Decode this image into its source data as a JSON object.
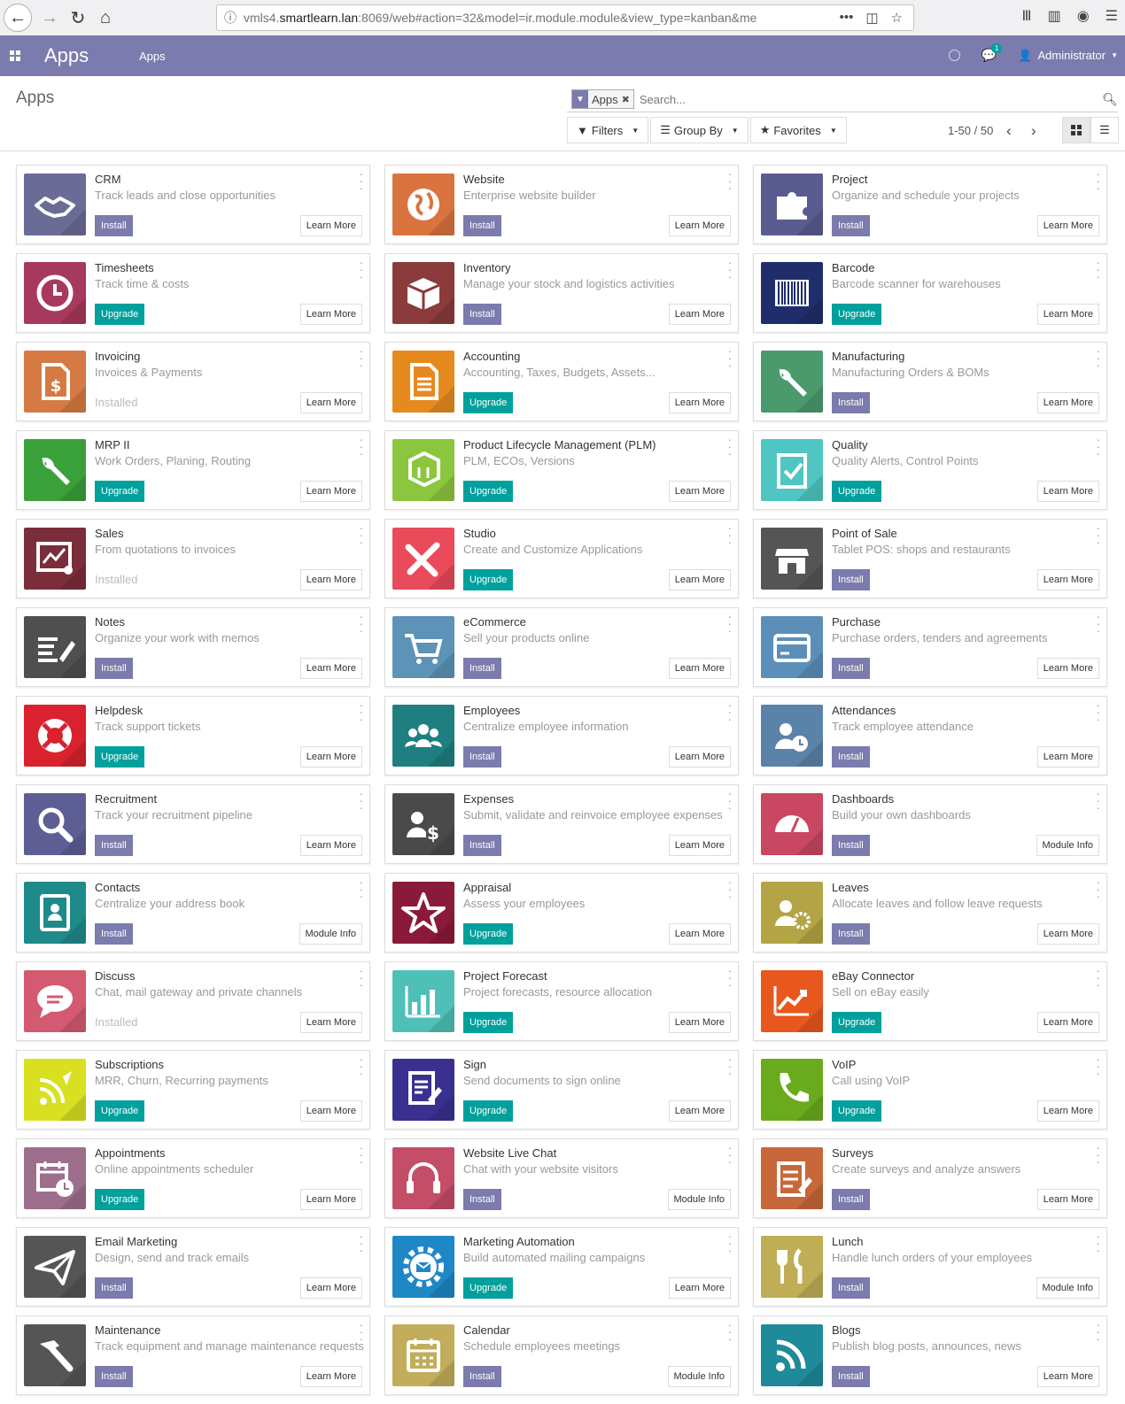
{
  "browser": {
    "url_prefix": "vmls4.",
    "url_host": "smartlearn.lan",
    "url_rest": ":8069/web#action=32&model=ir.module.module&view_type=kanban&me",
    "more_glyph": "•••"
  },
  "navbar": {
    "brand": "Apps",
    "menu_apps": "Apps",
    "chat_count": "1",
    "user": "Administrator",
    "color": "#7c7bad"
  },
  "control_panel": {
    "breadcrumb": "Apps",
    "facet": "Apps",
    "search_placeholder": "Search...",
    "filters_label": "Filters",
    "groupby_label": "Group By",
    "favorites_label": "Favorites",
    "pager": "1-50 / 50"
  },
  "colors": {
    "install": "#7c7bad",
    "upgrade": "#00a09d"
  },
  "apps": [
    {
      "name": "CRM",
      "summary": "Track leads and close opportunities",
      "state": "install",
      "info": "Learn More",
      "icon": "handshake-icon",
      "color": "#6b6b98"
    },
    {
      "name": "Website",
      "summary": "Enterprise website builder",
      "state": "install",
      "info": "Learn More",
      "icon": "globe-icon",
      "color": "#d9743f"
    },
    {
      "name": "Project",
      "summary": "Organize and schedule your projects",
      "state": "install",
      "info": "Learn More",
      "icon": "puzzle-icon",
      "color": "#5a5c8f"
    },
    {
      "name": "Timesheets",
      "summary": "Track time & costs",
      "state": "upgrade",
      "info": "Learn More",
      "icon": "clock-icon",
      "color": "#a73a5c"
    },
    {
      "name": "Inventory",
      "summary": "Manage your stock and logistics activities",
      "state": "install",
      "info": "Learn More",
      "icon": "box-icon",
      "color": "#8b3b3b"
    },
    {
      "name": "Barcode",
      "summary": "Barcode scanner for warehouses",
      "state": "upgrade",
      "info": "Learn More",
      "icon": "barcode-icon",
      "color": "#1f2d6b"
    },
    {
      "name": "Invoicing",
      "summary": "Invoices & Payments",
      "state": "installed",
      "state_text": "Installed",
      "info": "Learn More",
      "icon": "invoice-icon",
      "color": "#d67a44"
    },
    {
      "name": "Accounting",
      "summary": "Accounting, Taxes, Budgets, Assets...",
      "state": "upgrade",
      "info": "Learn More",
      "icon": "document-icon",
      "color": "#e68a1f"
    },
    {
      "name": "Manufacturing",
      "summary": "Manufacturing Orders & BOMs",
      "state": "install",
      "info": "Learn More",
      "icon": "wrench-icon",
      "color": "#4a9a6e"
    },
    {
      "name": "MRP II",
      "summary": "Work Orders, Planing, Routing",
      "state": "upgrade",
      "info": "Learn More",
      "icon": "wrench-icon",
      "color": "#3aa13a"
    },
    {
      "name": "Product Lifecycle Management (PLM)",
      "summary": "PLM, ECOs, Versions",
      "state": "upgrade",
      "info": "Learn More",
      "icon": "cube-icon",
      "color": "#8cc63f"
    },
    {
      "name": "Quality",
      "summary": "Quality Alerts, Control Points",
      "state": "upgrade",
      "info": "Learn More",
      "icon": "clipboard-check-icon",
      "color": "#4fc6c1"
    },
    {
      "name": "Sales",
      "summary": "From quotations to invoices",
      "state": "installed",
      "state_text": "Installed",
      "info": "Learn More",
      "icon": "chart-icon",
      "color": "#7b2d3a"
    },
    {
      "name": "Studio",
      "summary": "Create and Customize Applications",
      "state": "upgrade",
      "info": "Learn More",
      "icon": "tools-icon",
      "color": "#e94b5a"
    },
    {
      "name": "Point of Sale",
      "summary": "Tablet POS: shops and restaurants",
      "state": "install",
      "info": "Learn More",
      "icon": "shop-icon",
      "color": "#555555"
    },
    {
      "name": "Notes",
      "summary": "Organize your work with memos",
      "state": "install",
      "info": "Learn More",
      "icon": "notes-icon",
      "color": "#4f4f4f"
    },
    {
      "name": "eCommerce",
      "summary": "Sell your products online",
      "state": "install",
      "info": "Learn More",
      "icon": "cart-icon",
      "color": "#5c93b6"
    },
    {
      "name": "Purchase",
      "summary": "Purchase orders, tenders and agreements",
      "state": "install",
      "info": "Learn More",
      "icon": "card-icon",
      "color": "#5b8fba"
    },
    {
      "name": "Helpdesk",
      "summary": "Track support tickets",
      "state": "upgrade",
      "info": "Learn More",
      "icon": "lifebuoy-icon",
      "color": "#d9222e"
    },
    {
      "name": "Employees",
      "summary": "Centralize employee information",
      "state": "install",
      "info": "Learn More",
      "icon": "users-icon",
      "color": "#1f7f80"
    },
    {
      "name": "Attendances",
      "summary": "Track employee attendance",
      "state": "install",
      "info": "Learn More",
      "icon": "user-clock-icon",
      "color": "#5b83aa"
    },
    {
      "name": "Recruitment",
      "summary": "Track your recruitment pipeline",
      "state": "install",
      "info": "Learn More",
      "icon": "magnifier-icon",
      "color": "#5d5f94"
    },
    {
      "name": "Expenses",
      "summary": "Submit, validate and reinvoice employee expenses",
      "state": "install",
      "info": "Learn More",
      "icon": "user-dollar-icon",
      "color": "#4a4a4a"
    },
    {
      "name": "Dashboards",
      "summary": "Build your own dashboards",
      "state": "install",
      "info": "Module Info",
      "icon": "gauge-icon",
      "color": "#c94763"
    },
    {
      "name": "Contacts",
      "summary": "Centralize your address book",
      "state": "install",
      "info": "Module Info",
      "icon": "address-book-icon",
      "color": "#1f8a8a"
    },
    {
      "name": "Appraisal",
      "summary": "Assess your employees",
      "state": "upgrade",
      "info": "Learn More",
      "icon": "star-icon",
      "color": "#8a1a3a"
    },
    {
      "name": "Leaves",
      "summary": "Allocate leaves and follow leave requests",
      "state": "install",
      "info": "Learn More",
      "icon": "user-gear-icon",
      "color": "#b3a545"
    },
    {
      "name": "Discuss",
      "summary": "Chat, mail gateway and private channels",
      "state": "installed",
      "state_text": "Installed",
      "info": "Learn More",
      "icon": "chat-icon",
      "color": "#d45a71"
    },
    {
      "name": "Project Forecast",
      "summary": "Project forecasts, resource allocation",
      "state": "upgrade",
      "info": "Learn More",
      "icon": "bar-chart-icon",
      "color": "#4fc0b8"
    },
    {
      "name": "eBay Connector",
      "summary": "Sell on eBay easily",
      "state": "upgrade",
      "info": "Learn More",
      "icon": "trend-icon",
      "color": "#e8571c"
    },
    {
      "name": "Subscriptions",
      "summary": "MRR, Churn, Recurring payments",
      "state": "upgrade",
      "info": "Learn More",
      "icon": "rss-pen-icon",
      "color": "#d8e021"
    },
    {
      "name": "Sign",
      "summary": "Send documents to sign online",
      "state": "upgrade",
      "info": "Learn More",
      "icon": "sign-icon",
      "color": "#3a3090"
    },
    {
      "name": "VoIP",
      "summary": "Call using VoIP",
      "state": "upgrade",
      "info": "Learn More",
      "icon": "phone-icon",
      "color": "#6aab1e"
    },
    {
      "name": "Appointments",
      "summary": "Online appointments scheduler",
      "state": "upgrade",
      "info": "Learn More",
      "icon": "calendar-clock-icon",
      "color": "#9d6f8c"
    },
    {
      "name": "Website Live Chat",
      "summary": "Chat with your website visitors",
      "state": "install",
      "info": "Module Info",
      "icon": "headset-icon",
      "color": "#c44d67"
    },
    {
      "name": "Surveys",
      "summary": "Create surveys and analyze answers",
      "state": "install",
      "info": "Learn More",
      "icon": "survey-icon",
      "color": "#c8683a"
    },
    {
      "name": "Email Marketing",
      "summary": "Design, send and track emails",
      "state": "install",
      "info": "Learn More",
      "icon": "paper-plane-icon",
      "color": "#555555"
    },
    {
      "name": "Marketing Automation",
      "summary": "Build automated mailing campaigns",
      "state": "upgrade",
      "info": "Learn More",
      "icon": "gear-mail-icon",
      "color": "#1e88c7"
    },
    {
      "name": "Lunch",
      "summary": "Handle lunch orders of your employees",
      "state": "install",
      "info": "Module Info",
      "icon": "cutlery-icon",
      "color": "#bfae55"
    },
    {
      "name": "Maintenance",
      "summary": "Track equipment and manage maintenance requests",
      "state": "install",
      "info": "Learn More",
      "icon": "hammer-icon",
      "color": "#555555"
    },
    {
      "name": "Calendar",
      "summary": "Schedule employees meetings",
      "state": "install",
      "info": "Module Info",
      "icon": "calendar-icon",
      "color": "#c2ad5a"
    },
    {
      "name": "Blogs",
      "summary": "Publish blog posts, announces, news",
      "state": "install",
      "info": "Learn More",
      "icon": "rss-icon",
      "color": "#1f8a9a"
    }
  ]
}
